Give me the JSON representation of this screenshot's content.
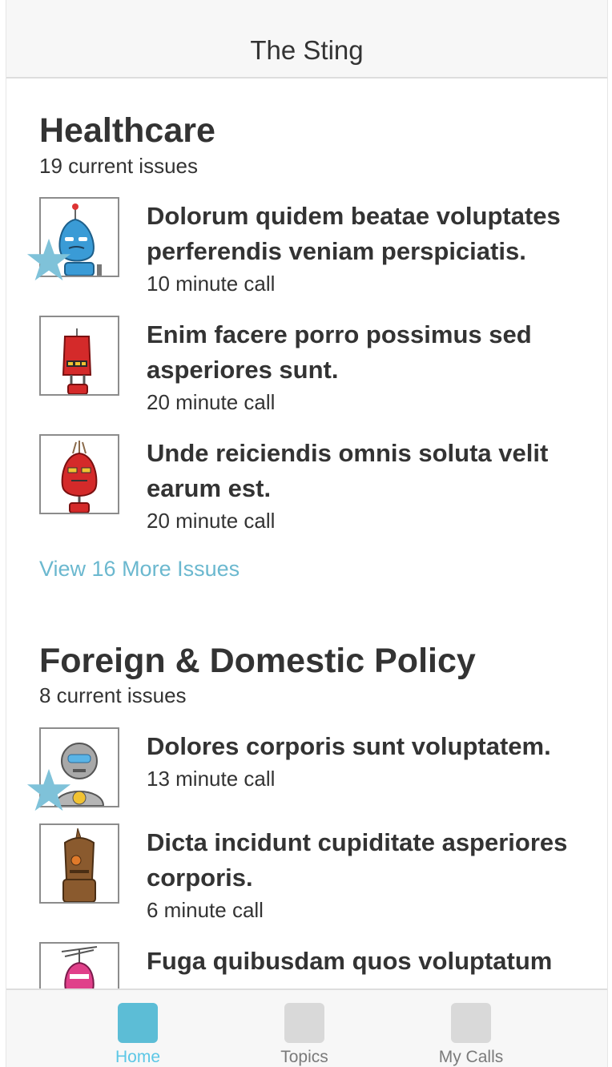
{
  "header": {
    "title": "The Sting"
  },
  "sections": [
    {
      "title": "Healthcare",
      "count_label": "19 current issues",
      "issues": [
        {
          "title": "Dolorum quidem beatae voluptates perferendis veniam perspiciatis.",
          "meta": "10 minute call",
          "starred": true,
          "robot_color": "#3a9bd6"
        },
        {
          "title": "Enim facere porro possimus sed asperiores sunt.",
          "meta": "20 minute call",
          "starred": false,
          "robot_color": "#d42a2a"
        },
        {
          "title": "Unde reiciendis omnis soluta velit earum est.",
          "meta": "20 minute call",
          "starred": false,
          "robot_color": "#d42a2a"
        }
      ],
      "more_link": "View 16 More Issues"
    },
    {
      "title": "Foreign & Domestic Policy",
      "count_label": "8 current issues",
      "issues": [
        {
          "title": "Dolores corporis sunt voluptatem.",
          "meta": "13 minute call",
          "starred": true,
          "robot_color": "#9a9a9a"
        },
        {
          "title": "Dicta incidunt cupiditate asperiores corporis.",
          "meta": "6 minute call",
          "starred": false,
          "robot_color": "#8a5a2e"
        },
        {
          "title": "Fuga quibusdam quos voluptatum",
          "meta": "",
          "starred": false,
          "robot_color": "#e0408a"
        }
      ]
    }
  ],
  "tabs": [
    {
      "label": "Home",
      "active": true,
      "icon": "home-icon"
    },
    {
      "label": "Topics",
      "active": false,
      "icon": "topics-icon"
    },
    {
      "label": "My Calls",
      "active": false,
      "icon": "calls-icon"
    }
  ],
  "colors": {
    "accent": "#5cbdd6",
    "link": "#6bb8cf",
    "star": "#7fc2d9"
  }
}
